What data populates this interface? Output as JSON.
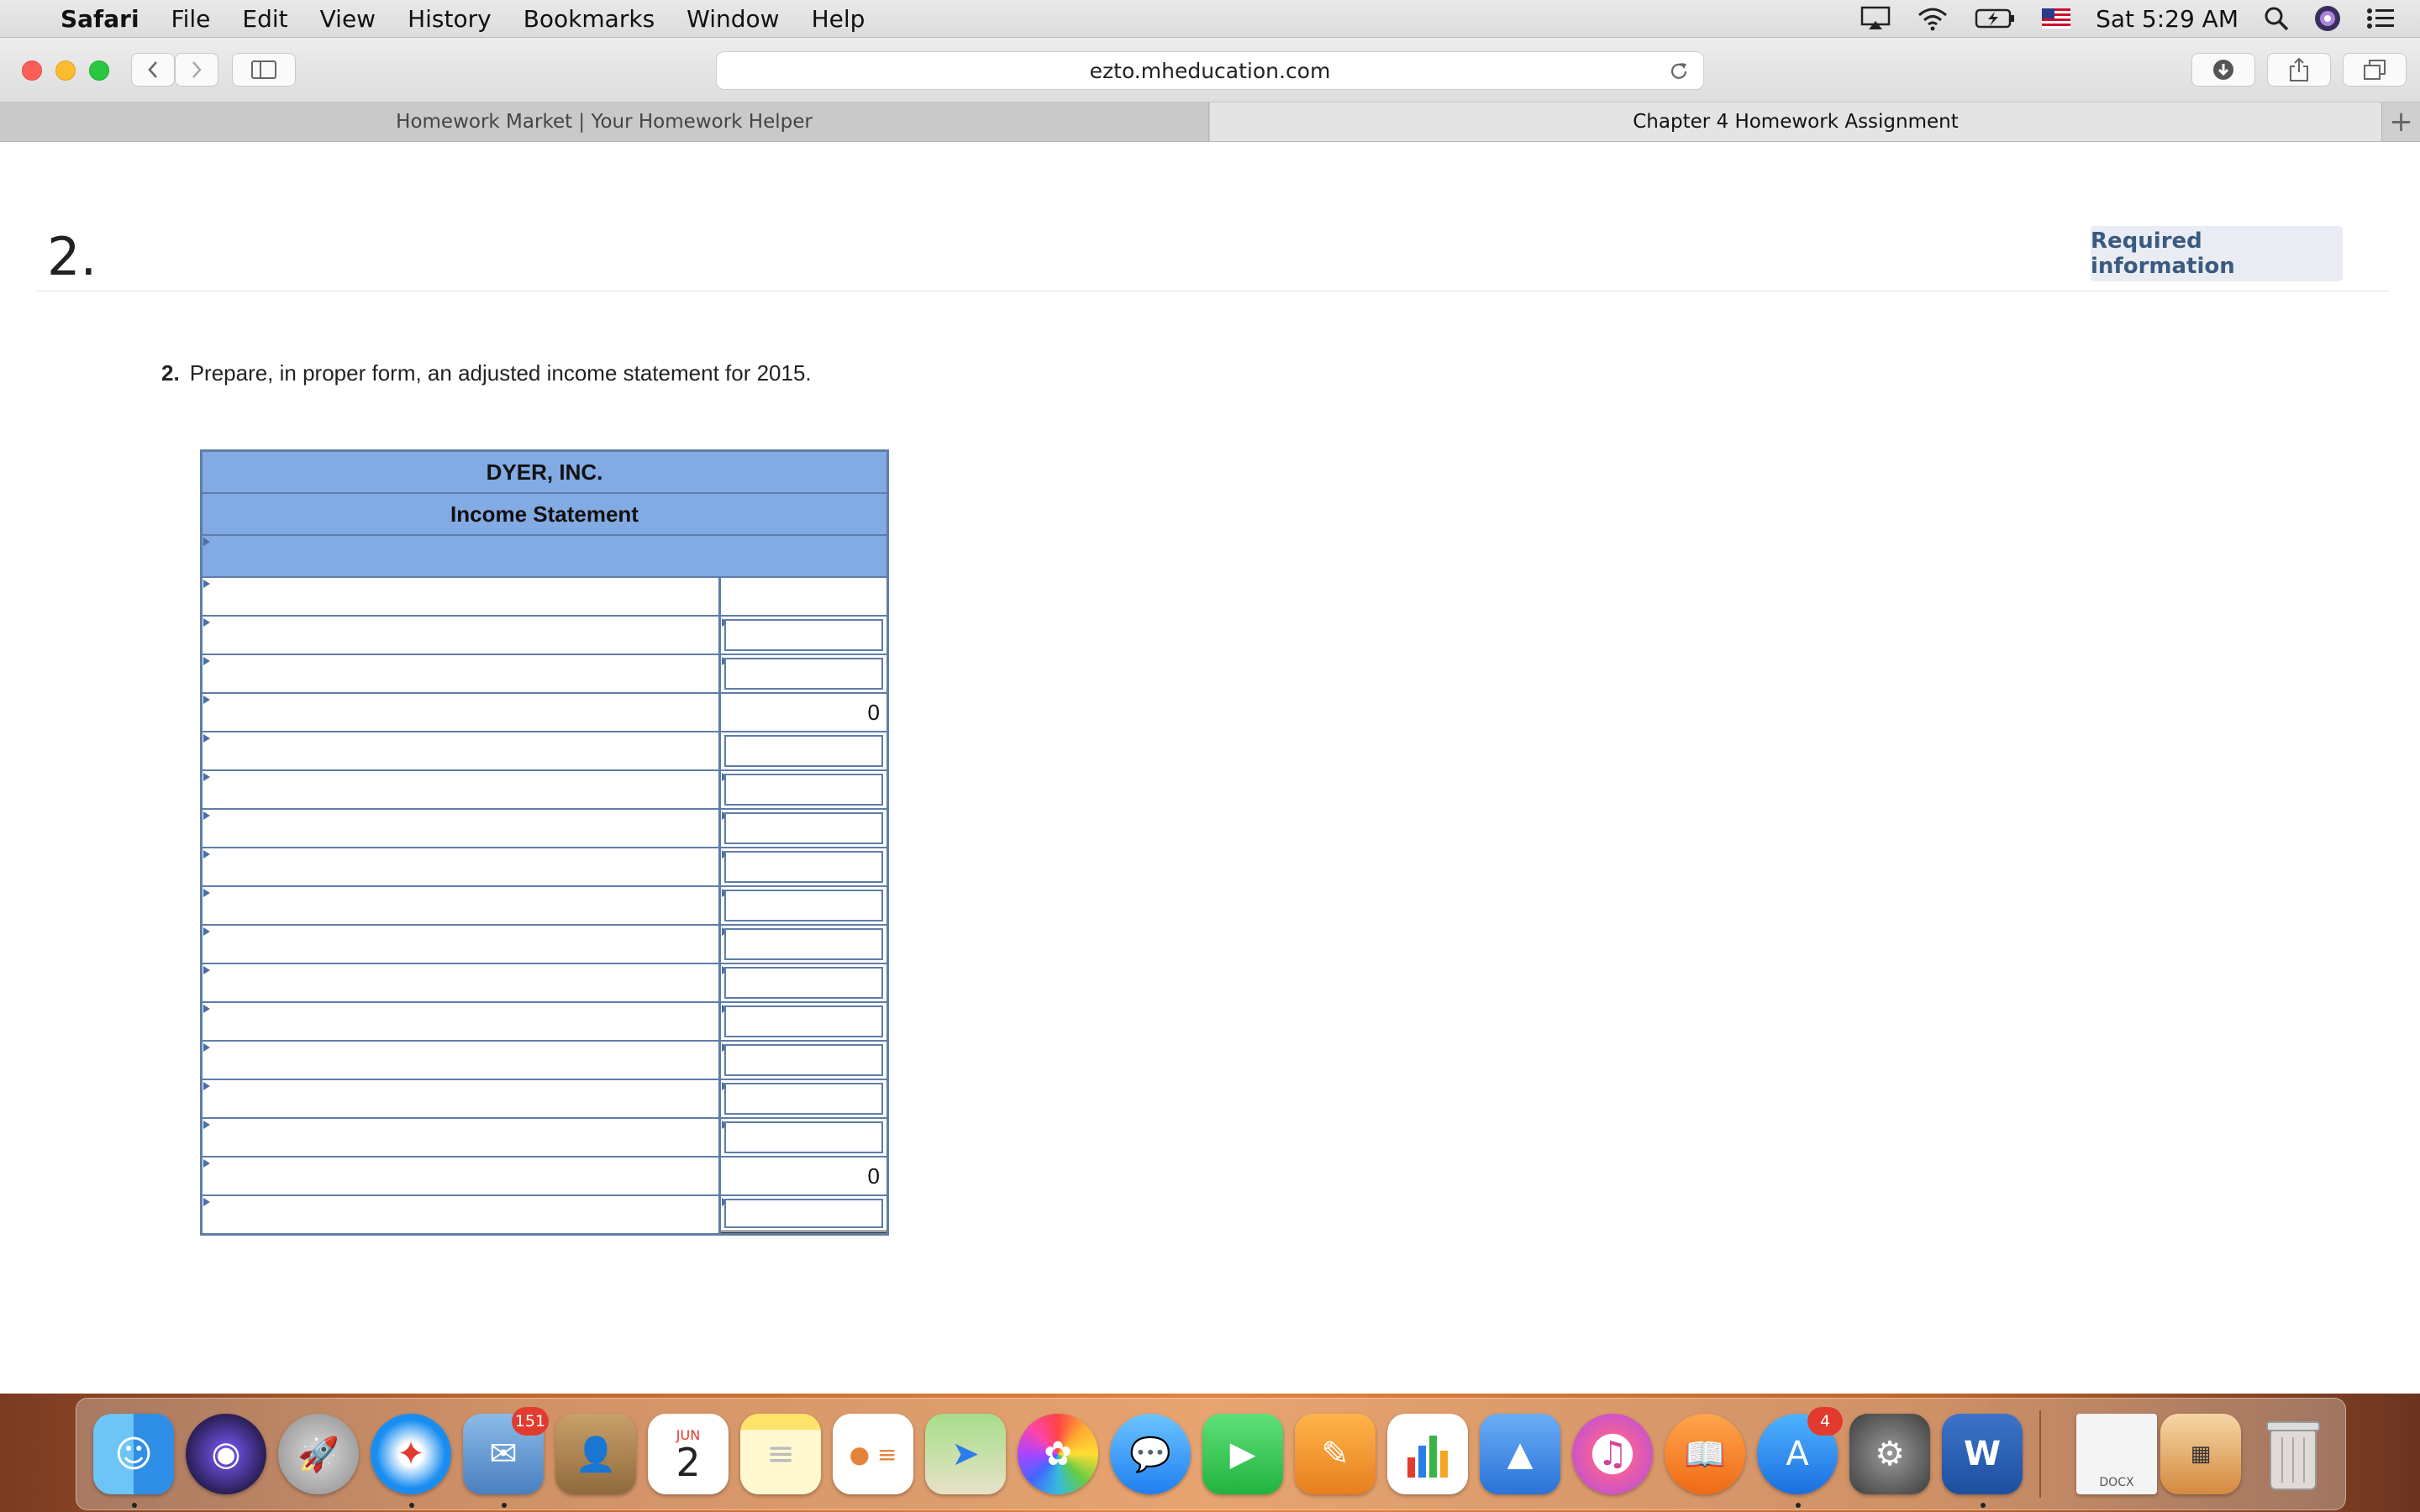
{
  "menubar": {
    "app_name": "Safari",
    "items": [
      "File",
      "Edit",
      "View",
      "History",
      "Bookmarks",
      "Window",
      "Help"
    ],
    "clock": "Sat 5:29 AM"
  },
  "browser": {
    "url": "ezto.mheducation.com",
    "tabs": [
      {
        "label": "Homework Market | Your Homework Helper"
      },
      {
        "label": "Chapter 4 Homework Assignment"
      }
    ],
    "new_tab_glyph": "+"
  },
  "question": {
    "number": "2.",
    "required_info_label": "Required information",
    "prompt_number": "2.",
    "prompt_text": "Prepare, in proper form, an adjusted income statement for 2015."
  },
  "statement": {
    "company": "DYER, INC.",
    "title": "Income Statement",
    "rows": [
      {
        "amount": ""
      },
      {
        "amount": ""
      },
      {
        "amount": ""
      },
      {
        "amount": "0"
      },
      {
        "amount": ""
      },
      {
        "amount": ""
      },
      {
        "amount": ""
      },
      {
        "amount": ""
      },
      {
        "amount": ""
      },
      {
        "amount": ""
      },
      {
        "amount": ""
      },
      {
        "amount": ""
      },
      {
        "amount": ""
      },
      {
        "amount": ""
      },
      {
        "amount": ""
      },
      {
        "amount": "0"
      },
      {
        "amount": ""
      }
    ]
  },
  "dock": {
    "mail_badge": "151",
    "calendar_month": "JUN",
    "calendar_day": "2",
    "appstore_badge": "4",
    "word_letter": "W",
    "docx_label": "DOCX"
  }
}
